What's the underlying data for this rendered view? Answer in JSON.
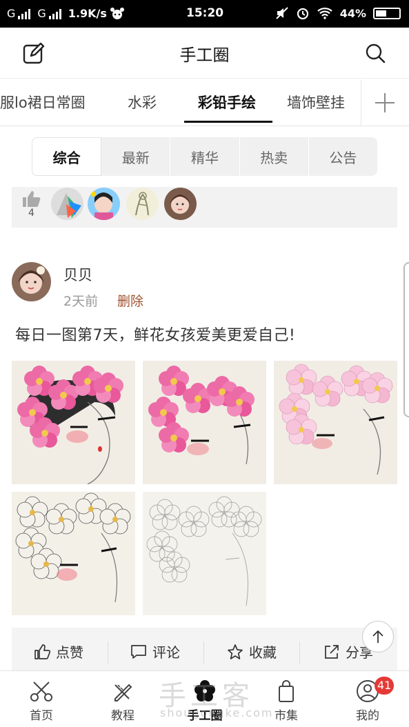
{
  "status_bar": {
    "carrier1": "G",
    "carrier2": "G",
    "speed": "1.9K/s",
    "time": "15:20",
    "battery": "44%"
  },
  "header": {
    "title": "手工圈",
    "icons": [
      "edit-icon",
      "search-icon"
    ]
  },
  "categories": {
    "items": [
      "服lo裙日常圈",
      "水彩",
      "彩铅手绘",
      "墙饰壁挂"
    ],
    "active": "彩铅手绘"
  },
  "sort_tabs": {
    "items": [
      "综合",
      "最新",
      "精华",
      "热卖",
      "公告"
    ],
    "active": "综合"
  },
  "likes_strip": {
    "count": "4"
  },
  "post": {
    "author": "贝贝",
    "time": "2天前",
    "delete_label": "删除",
    "content": "每日一图第7天，鲜花女孩爱美更爱自己!",
    "image_count": 5
  },
  "actions": {
    "like": "点赞",
    "comment": "评论",
    "favorite": "收藏",
    "share": "分享"
  },
  "bottom_nav": {
    "items": [
      "首页",
      "教程",
      "手工圈",
      "市集",
      "我的"
    ],
    "active": "手工圈",
    "badge": "41"
  },
  "watermark": {
    "main": "手工客",
    "sub": "shougongke.com"
  },
  "colors": {
    "accent_delete": "#a0522d",
    "badge": "#e53935",
    "flower_pink": "#e8589a"
  }
}
